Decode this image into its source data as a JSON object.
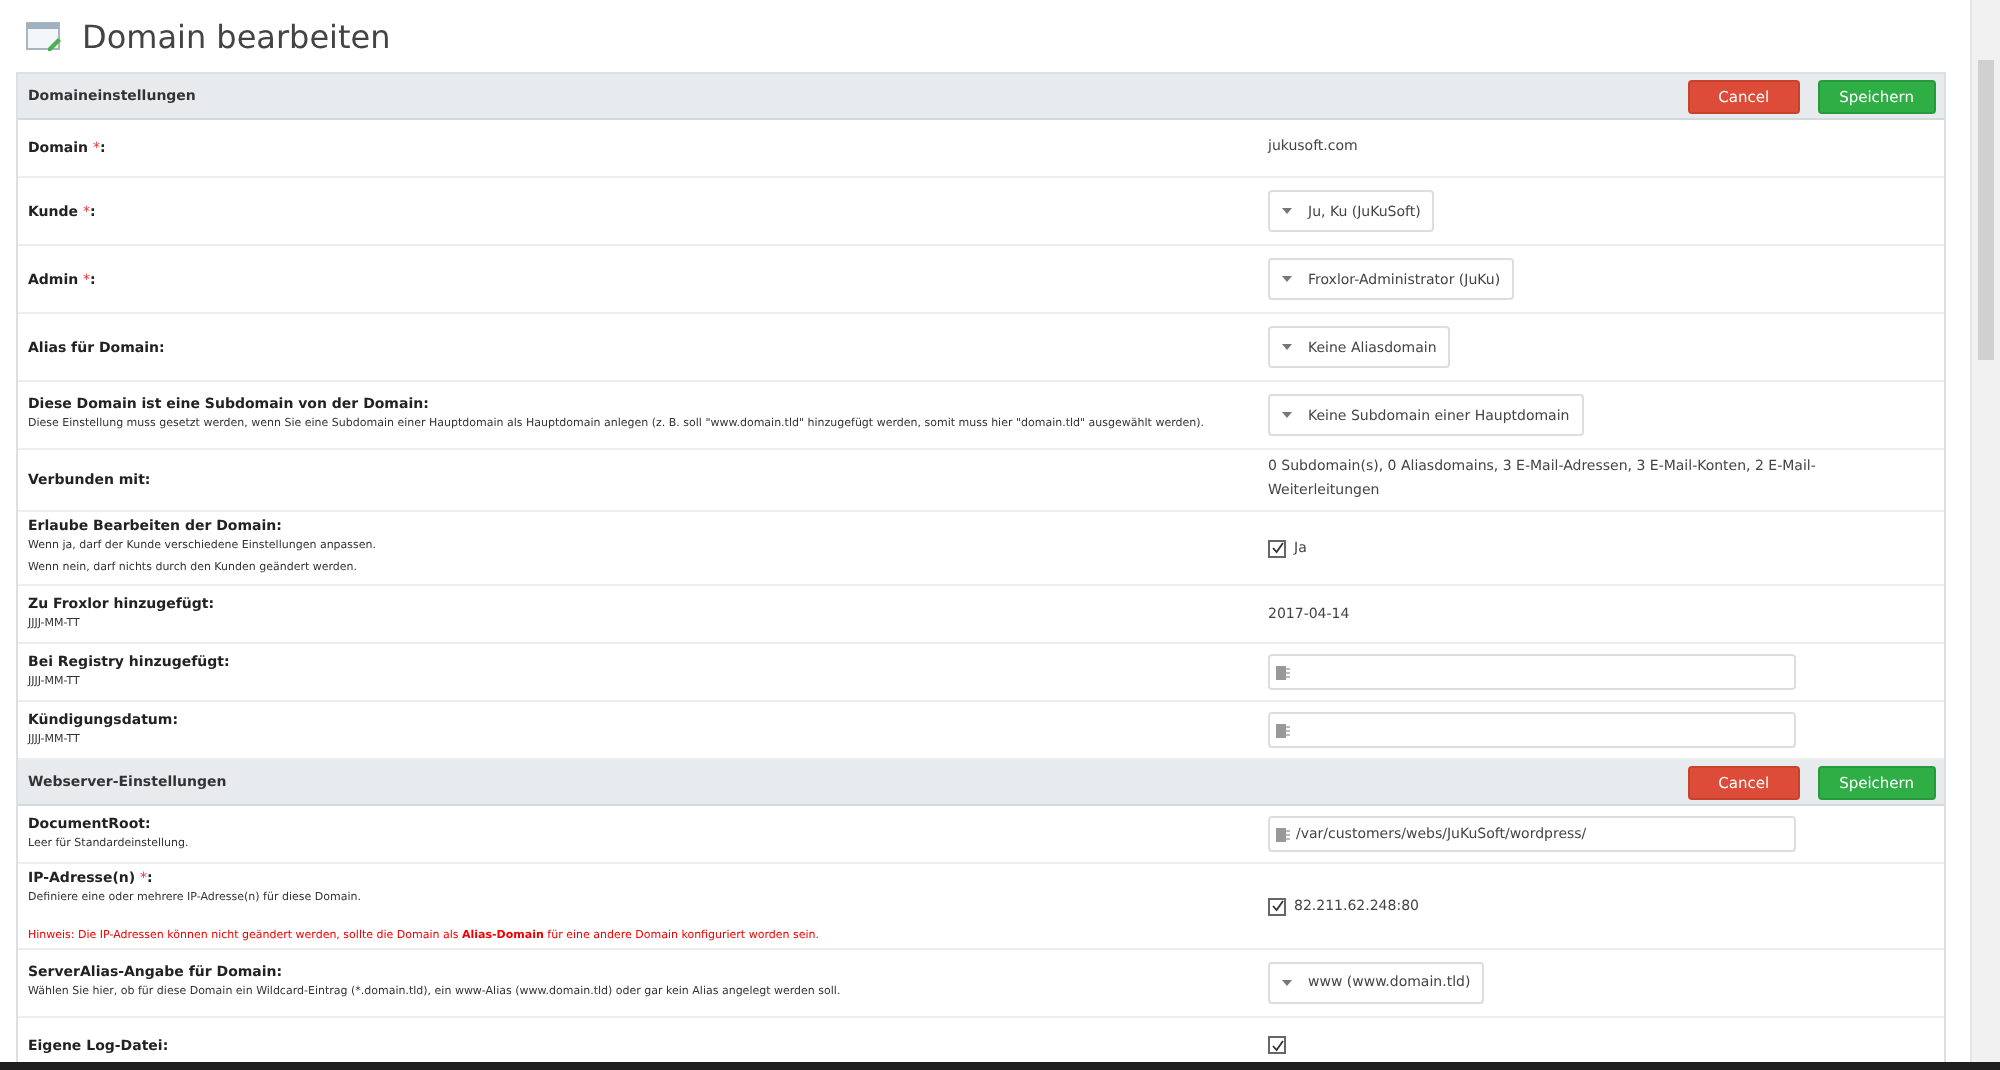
{
  "page": {
    "title": "Domain bearbeiten"
  },
  "sections": [
    {
      "title": "Domaineinstellungen",
      "buttons": [
        {
          "label": "Cancel",
          "kind": "cancel"
        },
        {
          "label": "Speichern",
          "kind": "save"
        }
      ],
      "rows": [
        {
          "label": "Domain",
          "required_mark": "*",
          "label_end": ":",
          "control": {
            "kind": "text",
            "value": "jukusoft.com"
          }
        },
        {
          "label": "Kunde",
          "required_mark": "*",
          "label_end": ":",
          "control": {
            "kind": "select",
            "value": "Ju, Ku (JuKuSoft)"
          }
        },
        {
          "label": "Admin",
          "required_mark": "*",
          "label_end": ":",
          "control": {
            "kind": "select",
            "value": "Froxlor-Administrator (JuKu)"
          }
        },
        {
          "label": "Alias für Domain:",
          "control": {
            "kind": "select",
            "value": "Keine Aliasdomain"
          }
        },
        {
          "label": "Diese Domain ist eine Subdomain von der Domain:",
          "description": [
            "Diese Einstellung muss gesetzt werden, wenn Sie eine Subdomain einer Hauptdomain als Hauptdomain anlegen (z. B. soll \"www.domain.tld\" hinzugefügt werden, somit muss hier \"domain.tld\" ausgewählt werden)."
          ],
          "control": {
            "kind": "select",
            "value": "Keine Subdomain einer Hauptdomain"
          }
        },
        {
          "label": "Verbunden mit:",
          "control": {
            "kind": "text",
            "value": "0 Subdomain(s), 0 Aliasdomains, 3 E-Mail-Adressen, 3 E-Mail-Konten, 2 E-Mail-Weiterleitungen"
          }
        },
        {
          "label": "Erlaube Bearbeiten der Domain:",
          "description": [
            "Wenn ja, darf der Kunde verschiedene Einstellungen anpassen.",
            "Wenn nein, darf nichts durch den Kunden geändert werden."
          ],
          "control": {
            "kind": "checkbox",
            "checked": true,
            "value": "Ja"
          }
        },
        {
          "label": "Zu Froxlor hinzugefügt:",
          "description": [
            "JJJJ-MM-TT"
          ],
          "control": {
            "kind": "text",
            "value": "2017-04-14"
          }
        },
        {
          "label": "Bei Registry hinzugefügt:",
          "description": [
            "JJJJ-MM-TT"
          ],
          "control": {
            "kind": "input"
          }
        },
        {
          "label": "Kündigungsdatum:",
          "description": [
            "JJJJ-MM-TT"
          ],
          "control": {
            "kind": "input"
          }
        }
      ]
    },
    {
      "title": "Webserver-Einstellungen",
      "buttons": [
        {
          "label": "Cancel",
          "kind": "cancel"
        },
        {
          "label": "Speichern",
          "kind": "save"
        }
      ],
      "rows": [
        {
          "label": "DocumentRoot:",
          "description": [
            "Leer für Standardeinstellung."
          ],
          "control": {
            "kind": "input",
            "value": "/var/customers/webs/JuKuSoft/wordpress/"
          }
        },
        {
          "label": "IP-Adresse(n)",
          "required_mark": "*",
          "label_end": ":",
          "description": [
            "Definiere eine oder mehrere IP-Adresse(n) für diese Domain."
          ],
          "note": "Hinweis: Die IP-Adressen können nicht geändert werden, sollte die Domain als **Alias-Domain** für eine andere Domain konfiguriert worden sein.",
          "control": {
            "kind": "checkbox",
            "checked": true,
            "value": "82.211.62.248:80"
          }
        },
        {
          "label": "ServerAlias-Angabe für Domain:",
          "description": [
            "Wählen Sie hier, ob für diese Domain ein Wildcard-Eintrag (*.domain.tld), ein www-Alias (www.domain.tld) oder gar kein Alias angelegt werden soll."
          ],
          "control": {
            "kind": "select",
            "value": "www (www.domain.tld)"
          }
        },
        {
          "label": "Eigene Log-Datei:",
          "control": {
            "kind": "checkbox",
            "checked": true
          }
        }
      ]
    }
  ]
}
